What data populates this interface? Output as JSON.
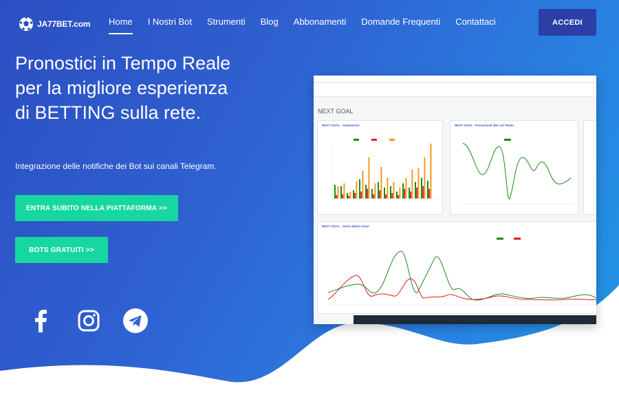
{
  "brand": {
    "name": "JA77BET.com"
  },
  "nav": {
    "items": [
      {
        "label": "Home",
        "active": true
      },
      {
        "label": "I Nostri Bot",
        "active": false
      },
      {
        "label": "Strumenti",
        "active": false
      },
      {
        "label": "Blog",
        "active": false
      },
      {
        "label": "Abbonamenti",
        "active": false
      },
      {
        "label": "Domande Frequenti",
        "active": false
      },
      {
        "label": "Contattaci",
        "active": false
      }
    ],
    "login_label": "ACCEDI"
  },
  "hero": {
    "headline": "Pronostici in Tempo Reale per la migliore esperienza di BETTING sulla rete.",
    "subline": "Integrazione delle notifiche dei Bot sui canali Telegram.",
    "cta_primary": "ENTRA SUBITO NELLA PIATTAFORMA >>",
    "cta_secondary": "BOTS GRATUITI >>"
  },
  "social": [
    {
      "icon": "facebook-icon"
    },
    {
      "icon": "instagram-icon"
    },
    {
      "icon": "telegram-icon"
    }
  ],
  "screenshot": {
    "page_title": "NEXT GOAL",
    "card_1_title": "NEXT GOAL - Andamento",
    "card_2_title": "NEXT GOAL - Percentuali Win sul Totale",
    "card_3_title": "NEXT GOAL - Serie ultimo mese"
  },
  "colors": {
    "accent": "#17d7a0",
    "login": "#2b3fa6",
    "bg_start": "#2b4fc2",
    "bg_end": "#1f99e6"
  }
}
